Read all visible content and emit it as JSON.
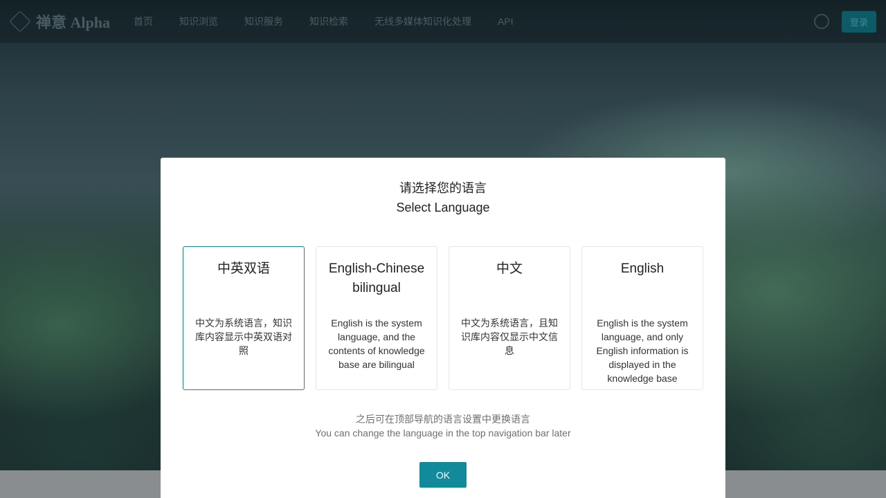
{
  "nav": {
    "logo_text": "禅意 Alpha",
    "items": [
      "首页",
      "知识浏览",
      "知识服务",
      "知识检索",
      "无线多媒体知识化处理",
      "API"
    ],
    "login_label": "登录"
  },
  "modal": {
    "title_zh": "请选择您的语言",
    "title_en": "Select Language",
    "options": [
      {
        "title": "中英双语",
        "desc": "中文为系统语言，知识库内容显示中英双语对照",
        "selected": true
      },
      {
        "title": "English-Chinese bilingual",
        "desc": "English is the system language, and the contents of knowledge base are bilingual",
        "selected": false
      },
      {
        "title": "中文",
        "desc": "中文为系统语言，且知识库内容仅显示中文信息",
        "selected": false
      },
      {
        "title": "English",
        "desc": "English is the system language, and only English information is displayed in the knowledge base",
        "selected": false
      }
    ],
    "hint_zh": "之后可在顶部导航的语言设置中更换语言",
    "hint_en": "You can change the language in the top navigation bar later",
    "ok_label": "OK"
  },
  "colors": {
    "accent": "#138a9c",
    "selected_border": "#17869a"
  }
}
